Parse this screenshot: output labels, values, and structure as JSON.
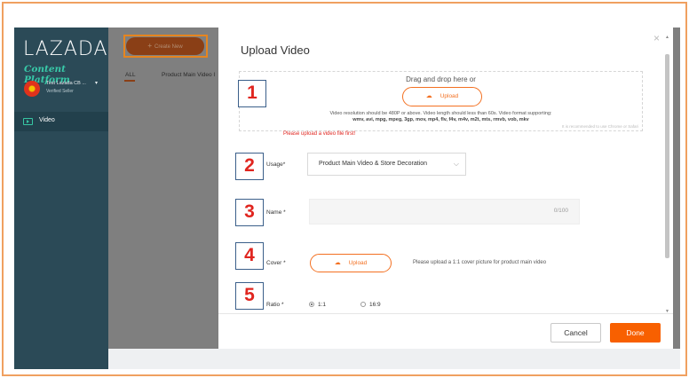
{
  "brand": {
    "logo_text": "LAZADA",
    "subtitle": "Content Platform"
  },
  "seller": {
    "name": "Test Lazada CB ...",
    "status": "Verified Seller",
    "caret": "▾"
  },
  "sidebar": {
    "items": [
      {
        "label": "Video",
        "icon": "video-icon",
        "active": true
      }
    ]
  },
  "content": {
    "create_button": {
      "plus": "+",
      "label": "Create New"
    },
    "tabs": [
      {
        "label": "ALL",
        "active": true
      },
      {
        "label": "Product Main Video I"
      }
    ]
  },
  "drawer": {
    "title": "Upload Video",
    "close_icon": "×",
    "upload_area": {
      "drop_text": "Drag and drop here or",
      "upload_label": "Upload",
      "upload_icon": "☁",
      "requirements_line1": "Video resolution should be 480P or above. Video length should less than 60s. Video format supporting:",
      "requirements_line2": "wmv, avi, mpg, mpeg, 3gp, mov, mp4, flv, f4v, m4v, m2t, mts, rmvb, vob, mkv",
      "browser_tip": "It is recommended to use Chrome or Safari",
      "error": "Please upload a video file first!"
    },
    "usage": {
      "label": "Usage*",
      "selected": "Product Main Video & Store Decoration",
      "chevron": "⌵"
    },
    "name": {
      "label": "Name *",
      "value": "",
      "counter": "0/100"
    },
    "cover": {
      "label": "Cover *",
      "upload_label": "Upload",
      "upload_icon": "☁",
      "hint": "Please upload a 1:1 cover picture for product main video"
    },
    "ratio": {
      "label": "Ratio *",
      "options": [
        {
          "label": "1:1",
          "selected": true
        },
        {
          "label": "16:9",
          "selected": false
        }
      ]
    },
    "footer": {
      "cancel": "Cancel",
      "done": "Done"
    }
  },
  "callouts": [
    "1",
    "2",
    "3",
    "4",
    "5"
  ],
  "colors": {
    "accent": "#f37021",
    "done_button": "#f86000",
    "error": "#e0251f",
    "sidebar": "#2b4a57",
    "brand_green": "#38c9a8",
    "callout_border": "#3b5f8a",
    "frame": "#f0a060"
  }
}
